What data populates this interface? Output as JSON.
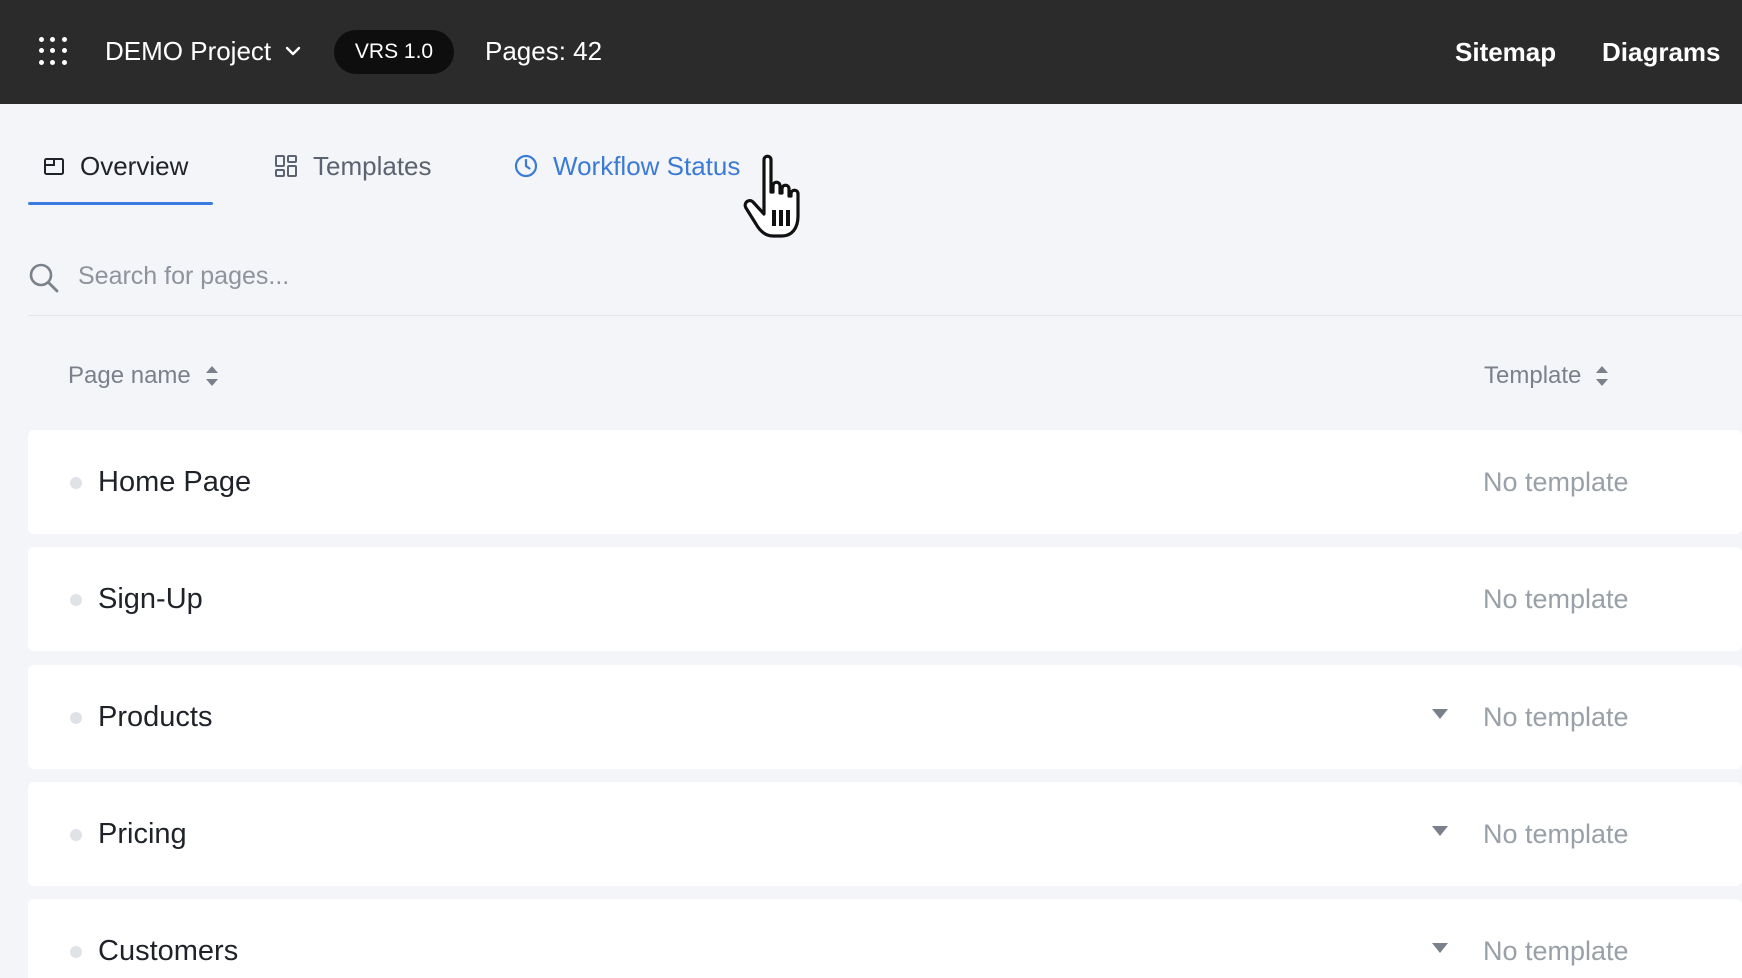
{
  "topbar": {
    "project_name": "DEMO Project",
    "version": "VRS 1.0",
    "pages_count": "Pages: 42",
    "links": [
      "Sitemap",
      "Diagrams"
    ],
    "apps_icon": "grid-dots-icon",
    "dropdown_icon": "chevron-down-icon"
  },
  "tabs": [
    {
      "label": "Overview",
      "icon": "overview-icon",
      "active": true
    },
    {
      "label": "Templates",
      "icon": "templates-icon",
      "active": false
    },
    {
      "label": "Workflow Status",
      "icon": "clock-icon",
      "active": false,
      "hovered": true
    }
  ],
  "search": {
    "placeholder": "Search for pages...",
    "value": "",
    "icon": "search-icon"
  },
  "table": {
    "columns": [
      "Page name",
      "Template"
    ],
    "rows": [
      {
        "name": "Home Page",
        "template": "No template",
        "expandable": false
      },
      {
        "name": "Sign-Up",
        "template": "No template",
        "expandable": false
      },
      {
        "name": "Products",
        "template": "No template",
        "expandable": true
      },
      {
        "name": "Pricing",
        "template": "No template",
        "expandable": true
      },
      {
        "name": "Customers",
        "template": "No template",
        "expandable": true
      }
    ]
  },
  "colors": {
    "topbar_bg": "#2b2b2b",
    "accent": "#3a7be0",
    "page_bg": "#f4f5f8"
  }
}
